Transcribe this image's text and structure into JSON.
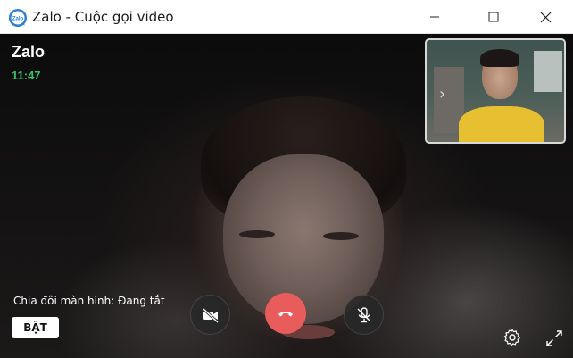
{
  "window": {
    "title": "Zalo - Cuộc gọi video",
    "logo_text": "Zalo",
    "controls": [
      "minimize-icon",
      "maximize-icon",
      "close-icon"
    ]
  },
  "call": {
    "caller_name": "Zalo",
    "duration": "11:47"
  },
  "screen_share": {
    "label": "Chia đôi màn hình: Đang tắt",
    "toggle_label": "BẬT"
  },
  "controls": {
    "camera_icon": "video-off-icon",
    "hangup_icon": "phone-hangup-icon",
    "mic_icon": "mic-off-icon",
    "settings_icon": "gear-icon",
    "fullscreen_icon": "expand-icon",
    "hangup_color": "#e85c5c"
  },
  "colors": {
    "time_green": "#35c46a",
    "logo_blue": "#2f7fd8"
  }
}
